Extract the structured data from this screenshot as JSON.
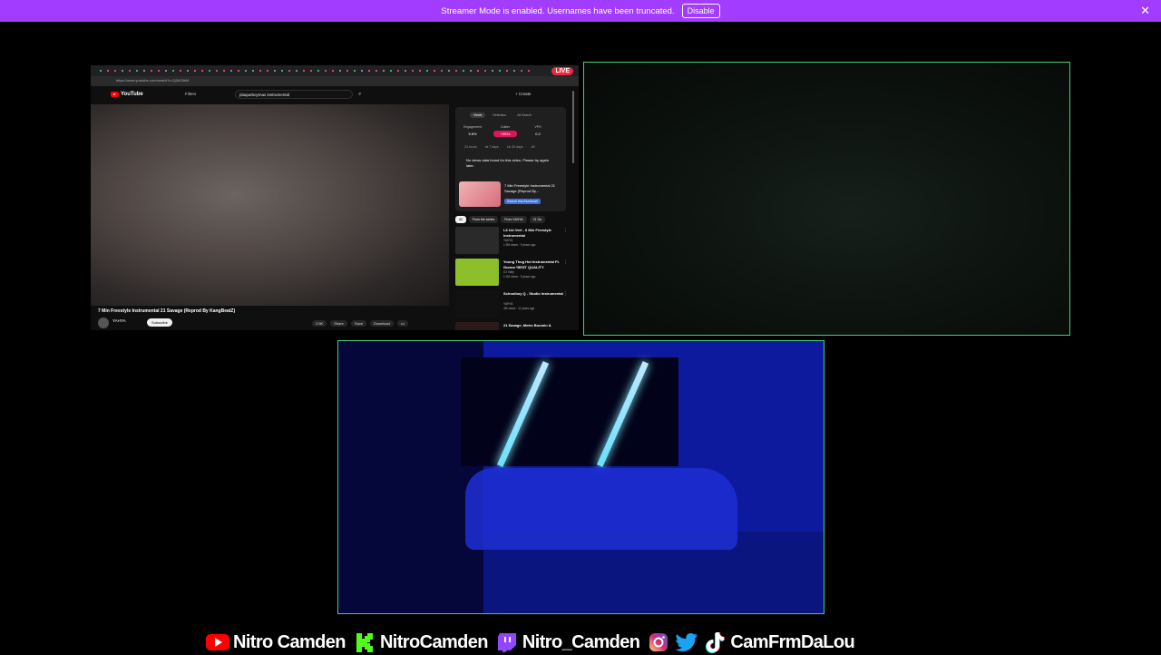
{
  "banner": {
    "text": "Streamer Mode is enabled. Usernames have been truncated.",
    "button": "Disable",
    "close": "✕"
  },
  "screen_share": {
    "live_badge": "LIVE",
    "url": "https://www.youtube.com/watch?v=Q0hZ8kM",
    "youtube": {
      "logo_text": "YouTube",
      "filters": "Filters",
      "search_value": "plaqueboymax instrumental",
      "create": "+ Create"
    },
    "video": {
      "title": "7 Min Freestyle Instrumental 21 Savage (Reprod By KangBeatZ)",
      "channel": "YAHYA",
      "subscribe": "Subscribe",
      "actions": [
        "2.5K",
        "Share",
        "Save",
        "Download",
        "•••"
      ]
    },
    "panel": {
      "tabs": [
        "Views",
        "Retention",
        "All Search"
      ],
      "stats": [
        {
          "label": "Engagement",
          "value": "5.8%",
          "hot": false
        },
        {
          "label": "Outlier",
          "value": "+992x",
          "hot": true
        },
        {
          "label": "VPH",
          "value": "0.2",
          "hot": false
        }
      ],
      "ranges": [
        "24 hours",
        "Ist 7 days",
        "1st 30 days",
        "All"
      ],
      "message": "No views data found for this video. Please try again later.",
      "video_title": "7 Min Freestyle Instrumental 21 Savage (Reprod By...",
      "video_badge": "Search this thumbnail"
    },
    "chips": [
      "All",
      "From the series",
      "From YAHYA",
      "21 Sa"
    ],
    "recommendations": [
      {
        "title": "Lil Uzi Vert - 6 Min Freestyle Instrumental",
        "meta": "YAHYA\n1.9M views · 9 years ago",
        "color": "#2a2a2a"
      },
      {
        "title": "Young Thug Hot Instrumental Ft. Gunna *BEST QUALITY",
        "meta": "DJ Volty\n1.2M views · 5 years ago",
        "color": "#8cbf2a"
      },
      {
        "title": "Schoolboy Q - Studio Instrumental",
        "meta": "YAHYA\n4M views · 11 years ago",
        "color": "#111111"
      },
      {
        "title": "21 Savage, Metro Boomin &",
        "meta": "",
        "color": "#2a1a1a"
      }
    ]
  },
  "socials": [
    {
      "icon": "youtube-icon",
      "text": "Nitro Camden",
      "color": "#ff0000"
    },
    {
      "icon": "kick-icon",
      "text": "NitroCamden",
      "color": "#53fc18"
    },
    {
      "icon": "twitch-icon",
      "text": "Nitro_Camden",
      "color": "#9146ff"
    },
    {
      "icon": "instagram-icon",
      "text": "",
      "color": "#e1306c"
    },
    {
      "icon": "twitter-icon",
      "text": "",
      "color": "#1da1f2"
    },
    {
      "icon": "tiktok-icon",
      "text": "CamFrmDaLou",
      "color": "#ffffff"
    }
  ]
}
